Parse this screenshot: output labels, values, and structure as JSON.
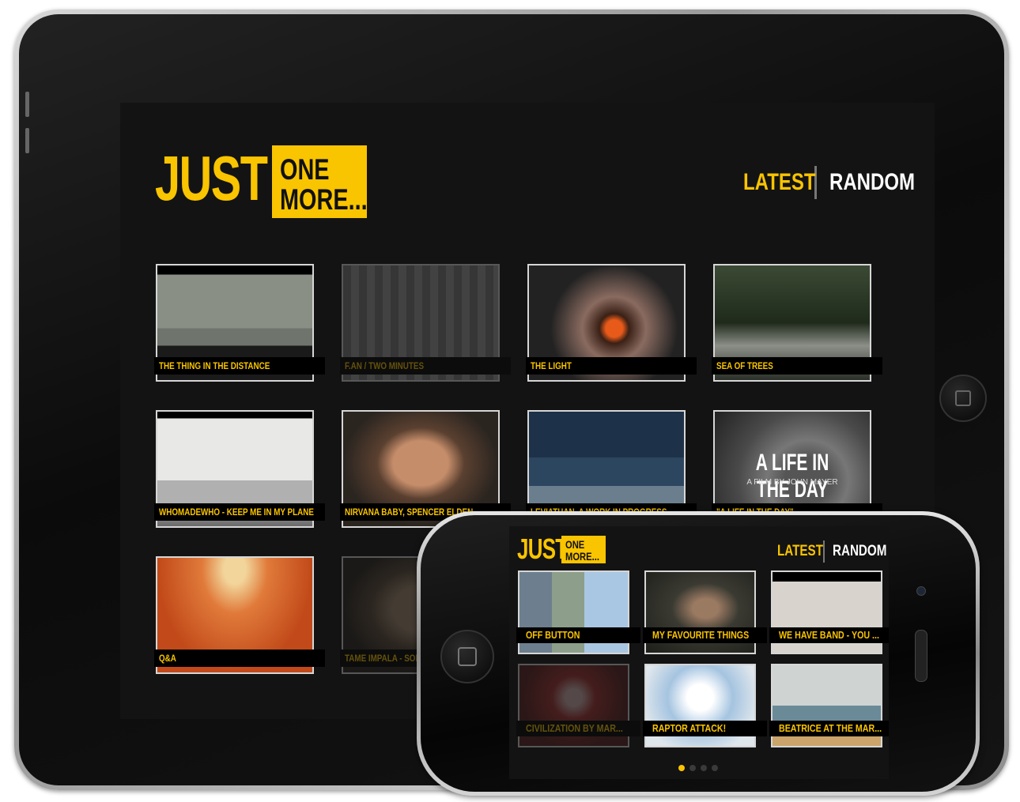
{
  "brand": {
    "just": "JUST",
    "one": "ONE",
    "more": "MORE...",
    "accent": "#f9c400"
  },
  "nav": {
    "latest": "LATEST",
    "random": "RANDOM"
  },
  "tablet_tiles": [
    {
      "title": "THE THING IN THE DISTANCE",
      "dim": false,
      "theme": "hill"
    },
    {
      "title": "F.AN / TWO MINUTES",
      "dim": true,
      "theme": "pattern"
    },
    {
      "title": "THE LIGHT",
      "dim": false,
      "theme": "burst"
    },
    {
      "title": "SEA OF TREES",
      "dim": false,
      "theme": "forest"
    },
    {
      "title": "WHOMADEWHO - KEEP ME IN MY PLANE",
      "dim": false,
      "theme": "toaster"
    },
    {
      "title": "NIRVANA BABY, SPENCER ELDEN",
      "dim": false,
      "theme": "portrait"
    },
    {
      "title": "LEVIATHAN, A WORK IN PROGRESS",
      "dim": false,
      "theme": "sea"
    },
    {
      "title": "\"A LIFE IN THE DAY\"",
      "dim": false,
      "theme": "cup",
      "overlay_title": "A LIFE IN THE DAY",
      "overlay_sub": "A FILM BY JOHN MAYER"
    },
    {
      "title": "Q&A",
      "dim": false,
      "theme": "cartoon"
    },
    {
      "title": "TAME IMPALA - SOLITUDE",
      "dim": true,
      "theme": "face"
    }
  ],
  "phone_tiles": [
    {
      "title": "OFF BUTTON",
      "dim": false,
      "theme": "robot"
    },
    {
      "title": "MY FAVOURITE THINGS",
      "dim": false,
      "theme": "girl"
    },
    {
      "title": "WE HAVE BAND - YOU ...",
      "dim": false,
      "theme": "eyes"
    },
    {
      "title": "CIVILIZATION BY MAR...",
      "dim": true,
      "theme": "red"
    },
    {
      "title": "RAPTOR ATTACK!",
      "dim": false,
      "theme": "sky"
    },
    {
      "title": "BEATRICE AT THE MAR...",
      "dim": false,
      "theme": "pool"
    }
  ],
  "pager": {
    "pages": 4,
    "current": 0
  }
}
